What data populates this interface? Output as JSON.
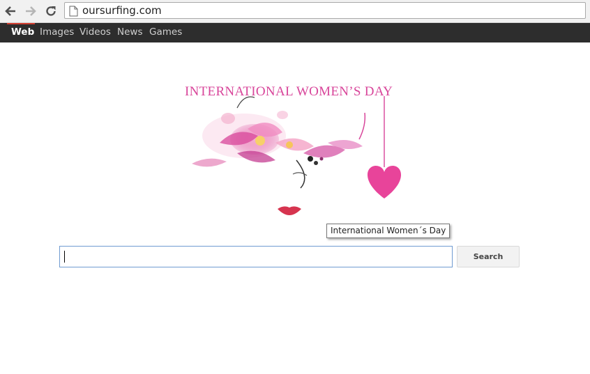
{
  "browser": {
    "url": "oursurfing.com",
    "icons": [
      "back-arrow-icon",
      "forward-arrow-icon",
      "reload-icon",
      "page-icon"
    ]
  },
  "topnav": {
    "items": [
      {
        "label": "Web",
        "active": true
      },
      {
        "label": "Images",
        "active": false
      },
      {
        "label": "Videos",
        "active": false
      },
      {
        "label": "News",
        "active": false
      },
      {
        "label": "Games",
        "active": false
      }
    ]
  },
  "logo": {
    "title": "INTERNATIONAL WOMEN’S DAY",
    "tooltip": "International Women´s Day",
    "accent": "#d8459a",
    "heart_color": "#e8449a"
  },
  "search": {
    "value": "",
    "button_label": "Search"
  }
}
